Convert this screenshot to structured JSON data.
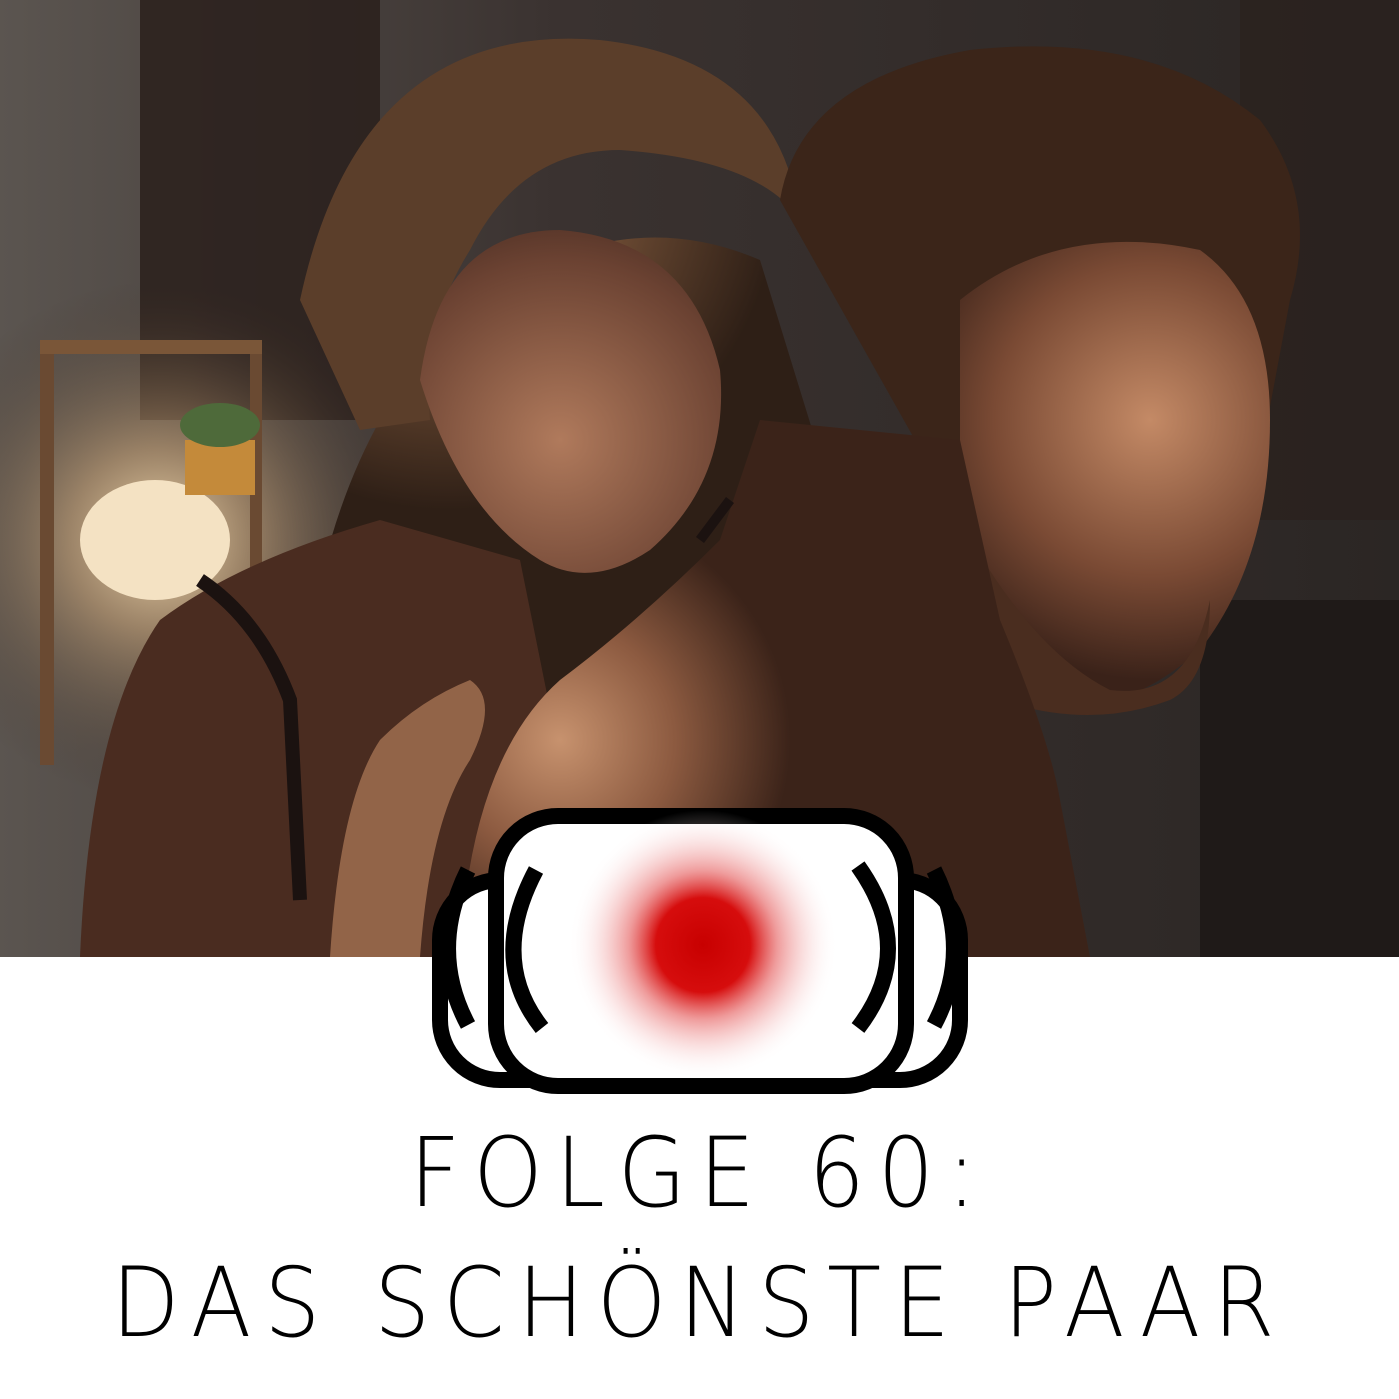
{
  "cover": {
    "title_line_1": "FOLGE 60:",
    "title_line_2": "DAS SCHÖNSTE PAAR"
  },
  "colors": {
    "background": "#ffffff",
    "logo_stroke": "#000000",
    "logo_dot": "#cc0000"
  },
  "icons": {
    "logo": "camera-lens-icon",
    "photo": "couple-photo"
  }
}
